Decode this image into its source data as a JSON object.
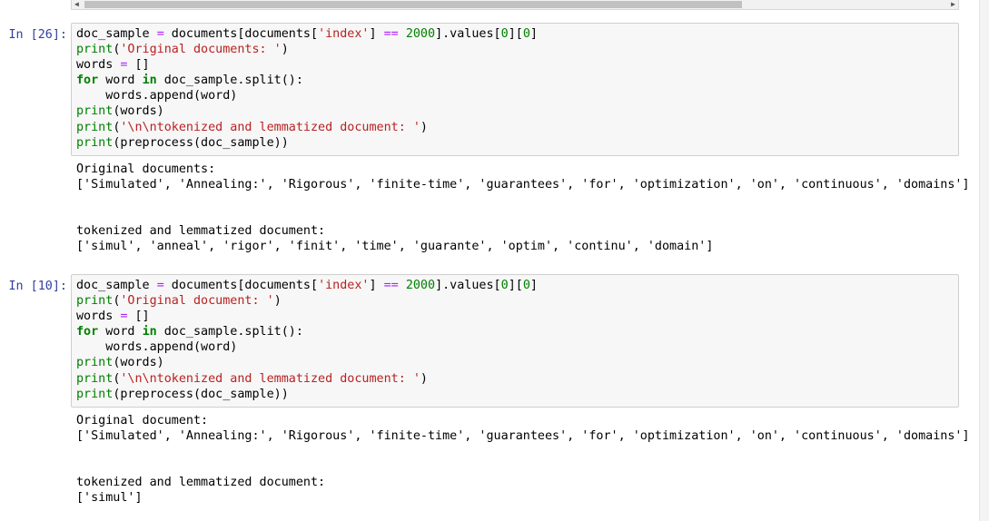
{
  "cells": [
    {
      "prompt": "In [26]:",
      "code": [
        [
          {
            "t": "doc_sample "
          },
          {
            "t": "=",
            "c": "op"
          },
          {
            "t": " documents[documents["
          },
          {
            "t": "'index'",
            "c": "str"
          },
          {
            "t": "] "
          },
          {
            "t": "==",
            "c": "op"
          },
          {
            "t": " "
          },
          {
            "t": "2000",
            "c": "num"
          },
          {
            "t": "].values["
          },
          {
            "t": "0",
            "c": "num"
          },
          {
            "t": "]["
          },
          {
            "t": "0",
            "c": "num"
          },
          {
            "t": "]"
          }
        ],
        [
          {
            "t": "print",
            "c": "bi"
          },
          {
            "t": "("
          },
          {
            "t": "'Original documents: '",
            "c": "str"
          },
          {
            "t": ")"
          }
        ],
        [
          {
            "t": "words "
          },
          {
            "t": "=",
            "c": "op"
          },
          {
            "t": " []"
          }
        ],
        [
          {
            "t": "for",
            "c": "kw"
          },
          {
            "t": " word "
          },
          {
            "t": "in",
            "c": "kw"
          },
          {
            "t": " doc_sample.split():"
          }
        ],
        [
          {
            "t": "    words.append(word)"
          }
        ],
        [
          {
            "t": "print",
            "c": "bi"
          },
          {
            "t": "(words)"
          }
        ],
        [
          {
            "t": "print",
            "c": "bi"
          },
          {
            "t": "("
          },
          {
            "t": "'\\n\\ntokenized and lemmatized document: '",
            "c": "str"
          },
          {
            "t": ")"
          }
        ],
        [
          {
            "t": "print",
            "c": "bi"
          },
          {
            "t": "(preprocess(doc_sample))"
          }
        ]
      ],
      "output": [
        "Original documents:",
        "['Simulated', 'Annealing:', 'Rigorous', 'finite-time', 'guarantees', 'for', 'optimization', 'on', 'continuous', 'domains']",
        "",
        "",
        "tokenized and lemmatized document:",
        "['simul', 'anneal', 'rigor', 'finit', 'time', 'guarante', 'optim', 'continu', 'domain']"
      ]
    },
    {
      "prompt": "In [10]:",
      "code": [
        [
          {
            "t": "doc_sample "
          },
          {
            "t": "=",
            "c": "op"
          },
          {
            "t": " documents[documents["
          },
          {
            "t": "'index'",
            "c": "str"
          },
          {
            "t": "] "
          },
          {
            "t": "==",
            "c": "op"
          },
          {
            "t": " "
          },
          {
            "t": "2000",
            "c": "num"
          },
          {
            "t": "].values["
          },
          {
            "t": "0",
            "c": "num"
          },
          {
            "t": "]["
          },
          {
            "t": "0",
            "c": "num"
          },
          {
            "t": "]"
          }
        ],
        [
          {
            "t": "print",
            "c": "bi"
          },
          {
            "t": "("
          },
          {
            "t": "'Original document: '",
            "c": "str"
          },
          {
            "t": ")"
          }
        ],
        [
          {
            "t": "words "
          },
          {
            "t": "=",
            "c": "op"
          },
          {
            "t": " []"
          }
        ],
        [
          {
            "t": "for",
            "c": "kw"
          },
          {
            "t": " word "
          },
          {
            "t": "in",
            "c": "kw"
          },
          {
            "t": " doc_sample.split():"
          }
        ],
        [
          {
            "t": "    words.append(word)"
          }
        ],
        [
          {
            "t": "print",
            "c": "bi"
          },
          {
            "t": "(words)"
          }
        ],
        [
          {
            "t": "print",
            "c": "bi"
          },
          {
            "t": "("
          },
          {
            "t": "'\\n\\ntokenized and lemmatized document: '",
            "c": "str"
          },
          {
            "t": ")"
          }
        ],
        [
          {
            "t": "print",
            "c": "bi"
          },
          {
            "t": "(preprocess(doc_sample))"
          }
        ]
      ],
      "output": [
        "Original document:",
        "['Simulated', 'Annealing:', 'Rigorous', 'finite-time', 'guarantees', 'for', 'optimization', 'on', 'continuous', 'domains']",
        "",
        "",
        "tokenized and lemmatized document:",
        "['simul']"
      ]
    }
  ],
  "colors": {
    "prompt": "#303f9f",
    "keyword": "#008000",
    "string": "#ba2121",
    "operator": "#aa22ff",
    "number": "#008000"
  }
}
